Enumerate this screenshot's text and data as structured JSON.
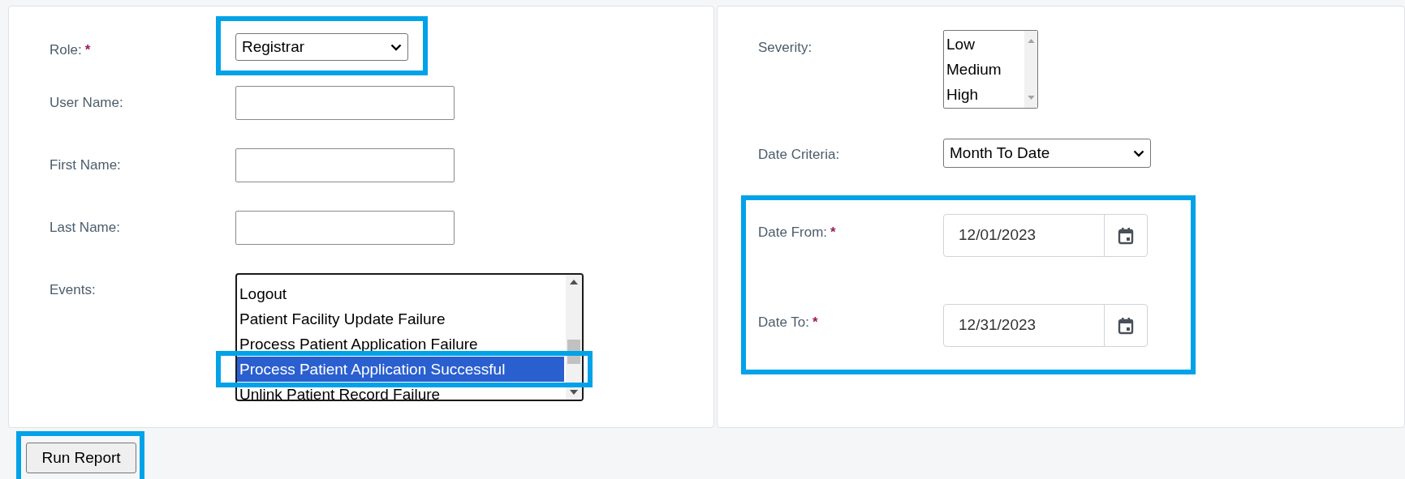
{
  "left_panel": {
    "role": {
      "label": "Role:",
      "required": "*",
      "value": "Registrar",
      "highlighted": true
    },
    "text_fields": [
      {
        "label": "User Name:"
      },
      {
        "label": "First Name:"
      },
      {
        "label": "Last Name:"
      }
    ],
    "events": {
      "label": "Events:",
      "items": [
        {
          "text": "Logout",
          "selected": false,
          "highlighted": false
        },
        {
          "text": "Patient Facility Update Failure",
          "selected": false,
          "highlighted": false
        },
        {
          "text": "Process Patient Application Failure",
          "selected": false,
          "highlighted": false
        },
        {
          "text": "Process Patient Application Successful",
          "selected": true,
          "highlighted": true
        },
        {
          "text": "Unlink Patient Record Failure",
          "selected": false,
          "highlighted": false
        }
      ]
    }
  },
  "right_panel": {
    "severity": {
      "label": "Severity:",
      "items": [
        "Low",
        "Medium",
        "High"
      ]
    },
    "date_criteria": {
      "label": "Date Criteria:",
      "value": "Month To Date"
    },
    "dates_highlighted": true,
    "dates": [
      {
        "label": "Date From:",
        "required": "*",
        "value": "12/01/2023"
      },
      {
        "label": "Date To:",
        "required": "*",
        "value": "12/31/2023"
      }
    ]
  },
  "run_button": {
    "label": "Run Report",
    "highlighted": true
  }
}
